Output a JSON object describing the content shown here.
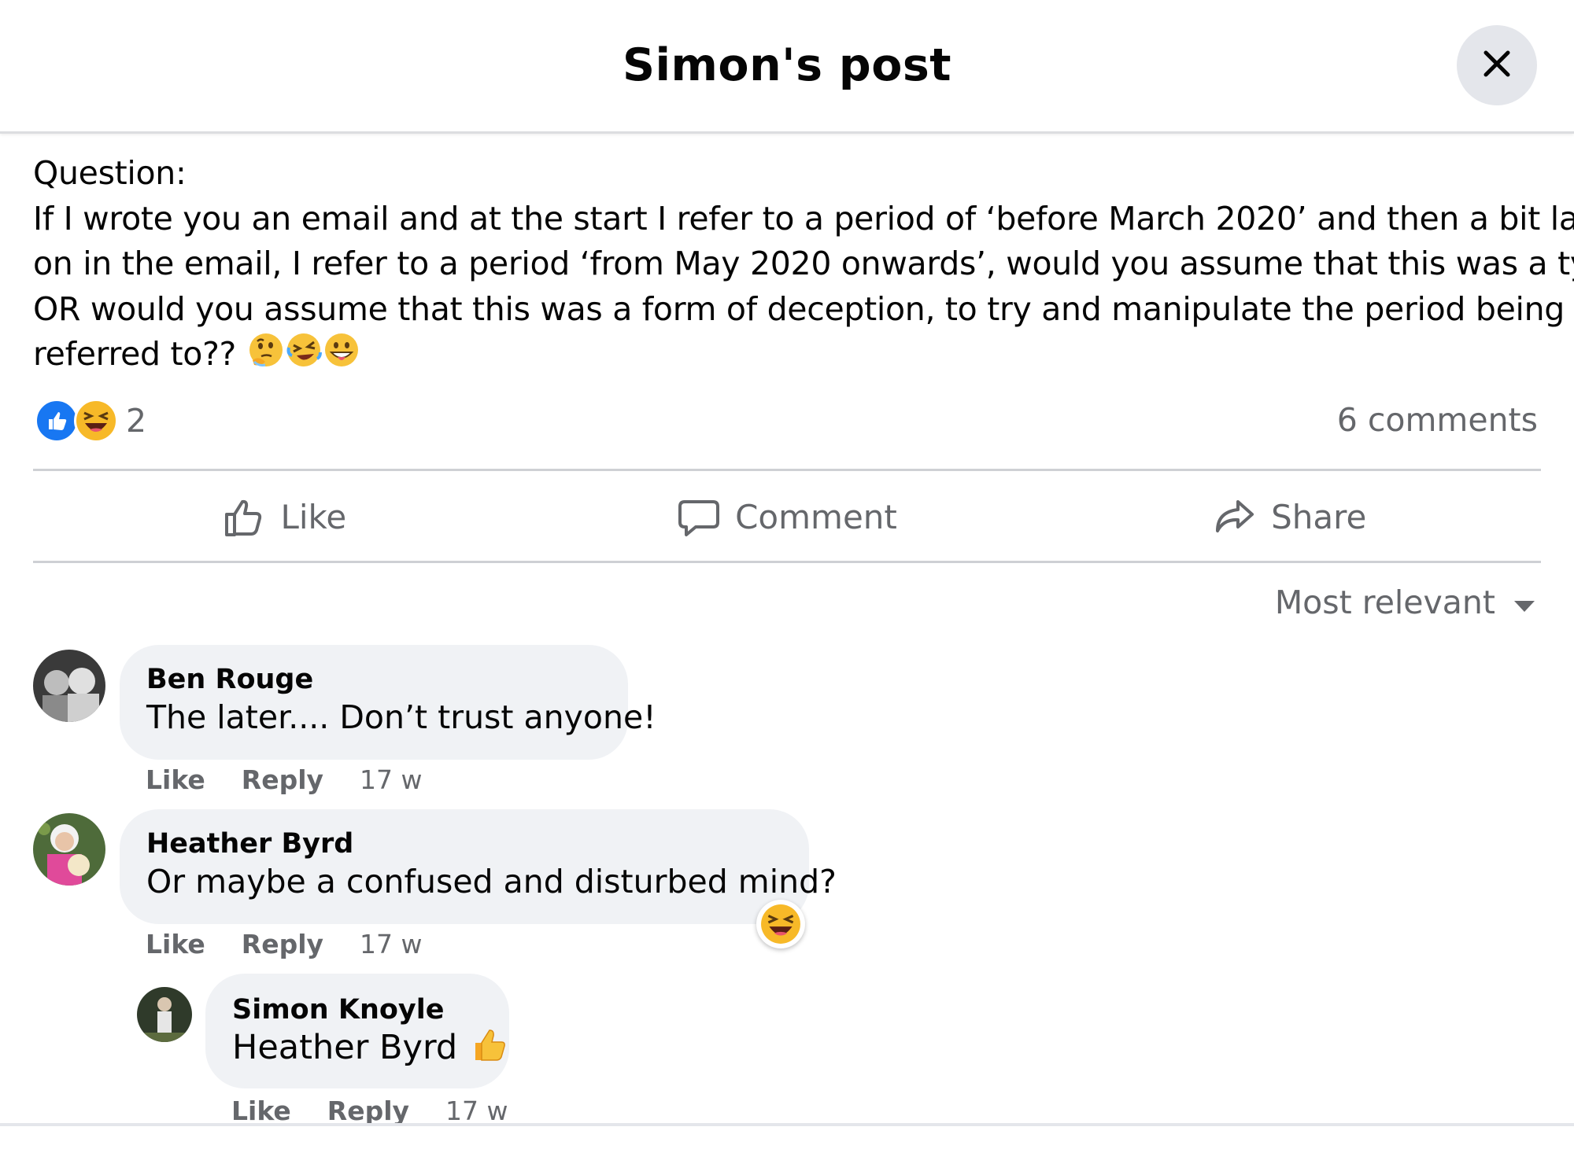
{
  "dialog": {
    "title": "Simon's post",
    "close_icon": "close-icon"
  },
  "post": {
    "text_lines": [
      "Question:",
      "If I wrote you an email and at the start I refer to a period of ‘before March 2020’ and then a bit later",
      "on in the email, I refer to a period ‘from May 2020 onwards’, would you assume that this was a typo",
      "OR would you assume that this was a form of deception, to try and manipulate the period being",
      "referred to??"
    ],
    "emojis": [
      "thinking-face-emoji",
      "rolling-laughing-emoji",
      "grinning-tongue-emoji"
    ],
    "reactions": {
      "icons": [
        "like-reaction-icon",
        "haha-reaction-icon"
      ],
      "count": "2"
    },
    "comments_count": "6 comments"
  },
  "actions": {
    "like": "Like",
    "comment": "Comment",
    "share": "Share"
  },
  "sort": {
    "label": "Most relevant"
  },
  "comments": [
    {
      "author": "Ben Rouge",
      "text": "The later.... Don’t trust anyone!",
      "like": "Like",
      "reply": "Reply",
      "time": "17 w"
    },
    {
      "author": "Heather Byrd",
      "text": "Or maybe a confused and disturbed mind?",
      "like": "Like",
      "reply": "Reply",
      "time": "17 w",
      "reaction": "haha-reaction-icon"
    },
    {
      "author": "Simon Knoyle",
      "text": "Heather Byrd",
      "like": "Like",
      "reply": "Reply",
      "time": "17 w",
      "emoji": "thumbs-up-emoji"
    }
  ],
  "colors": {
    "primary_text": "#050505",
    "secondary_text": "#65676b",
    "bubble_bg": "#f0f2f5",
    "like_blue": "#1877f2",
    "haha_yellow": "#f7b928"
  }
}
